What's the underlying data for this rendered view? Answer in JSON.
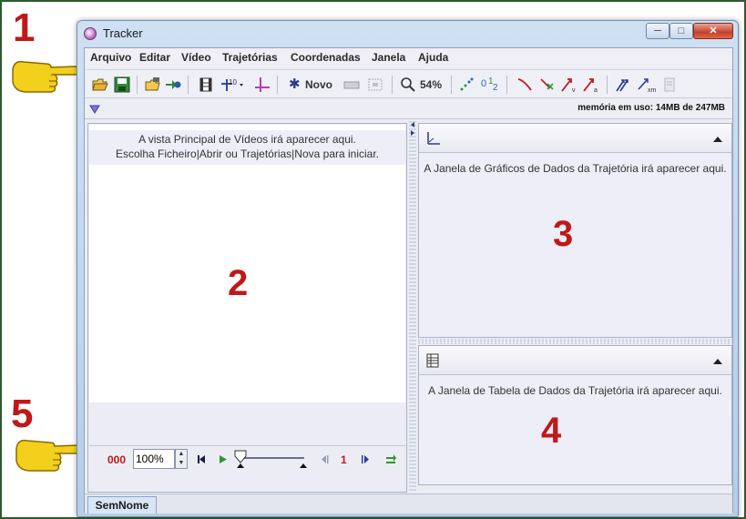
{
  "window": {
    "title": "Tracker"
  },
  "menu": [
    "Arquivo",
    "Editar",
    "Vídeo",
    "Trajetórias",
    "Coordenadas",
    "Janela",
    "Ajuda"
  ],
  "toolbar": {
    "new_track_label": "Novo",
    "zoom": "54%"
  },
  "info": {
    "memory": "memória em uso: 14MB de 247MB"
  },
  "video": {
    "message_line1": "A vista Principal de Vídeos irá aparecer aqui.",
    "message_line2": "Escolha Ficheiro|Abrir ou Trajetórias|Nova para iniciar."
  },
  "player": {
    "frame_counter": "000",
    "rate": "100%",
    "step": "1"
  },
  "graph": {
    "message": "A Janela de Gráficos de Dados da Trajetória irá aparecer aqui."
  },
  "table": {
    "message": "A Janela de Tabela de Dados da Trajetória irá aparecer aqui."
  },
  "tabs": {
    "active": "SemNome"
  },
  "annotations": {
    "n1": "1",
    "n2": "2",
    "n3": "3",
    "n4": "4",
    "n5": "5"
  },
  "colors": {
    "annotation": "#c01818",
    "hand": "#f2d01c"
  }
}
